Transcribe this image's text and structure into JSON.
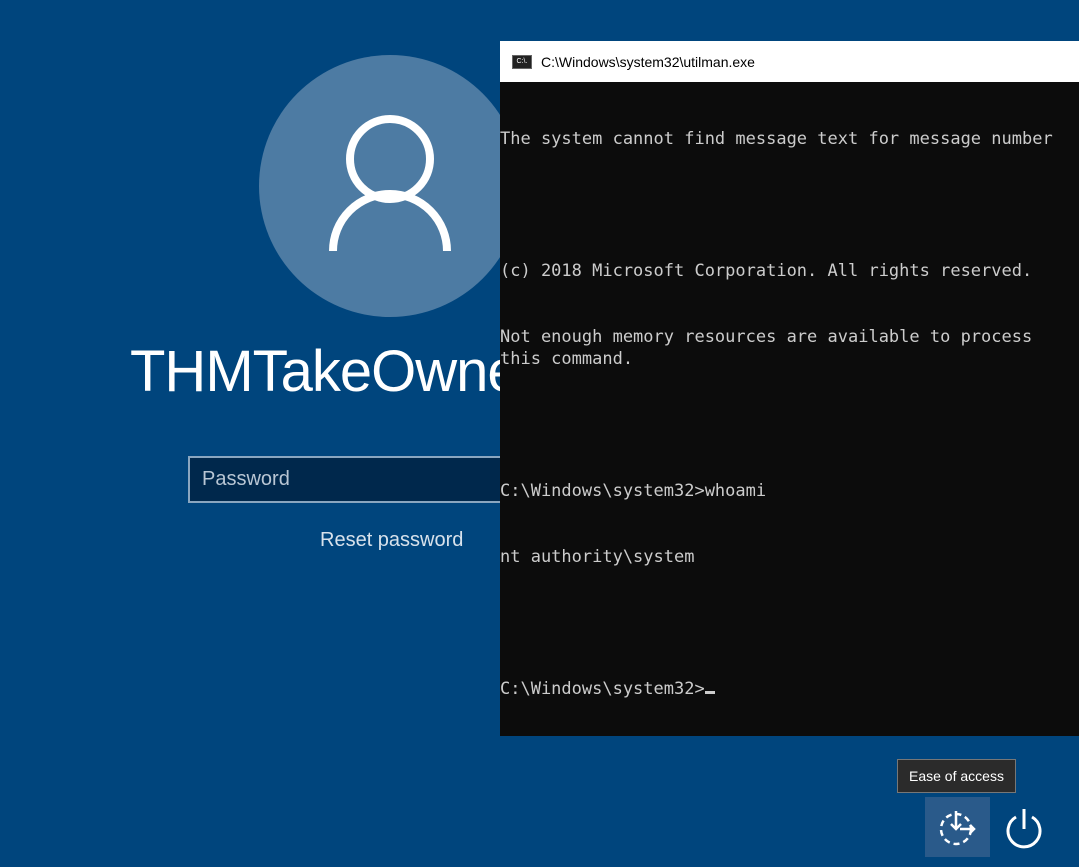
{
  "login": {
    "username": "THMTakeOwnership",
    "password_placeholder": "Password",
    "reset_password": "Reset password"
  },
  "console": {
    "title": "C:\\Windows\\system32\\utilman.exe",
    "icon_text": "C:\\.",
    "lines": [
      "The system cannot find message text for message number",
      "",
      "(c) 2018 Microsoft Corporation. All rights reserved.",
      "Not enough memory resources are available to process this command.",
      "",
      "C:\\Windows\\system32>whoami",
      "nt authority\\system",
      "",
      "C:\\Windows\\system32>"
    ]
  },
  "bottom": {
    "tooltip": "Ease of access"
  }
}
